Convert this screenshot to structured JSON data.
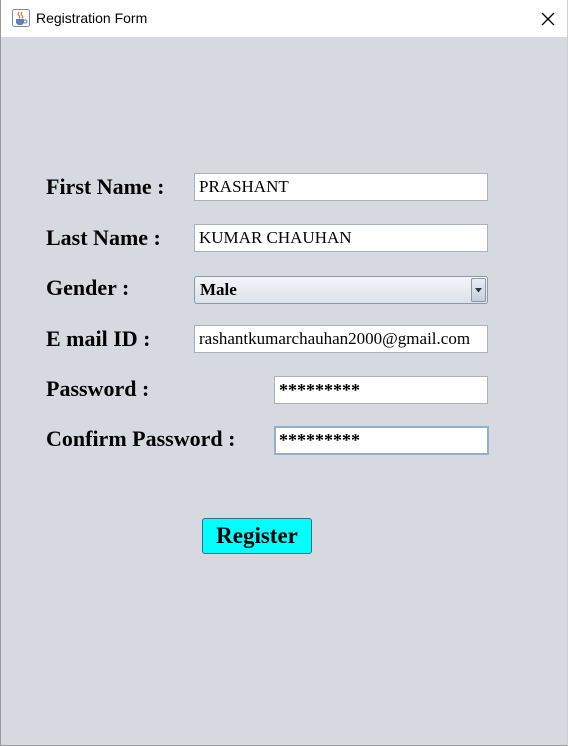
{
  "window": {
    "title": "Registration Form",
    "icons": {
      "app": "java-cup-icon",
      "close": "close-icon"
    }
  },
  "form": {
    "first_name": {
      "label": "First Name :",
      "value": "PRASHANT"
    },
    "last_name": {
      "label": "Last Name :",
      "value": "KUMAR CHAUHAN"
    },
    "gender": {
      "label": "Gender :",
      "selected": "Male"
    },
    "email": {
      "label": "E mail ID :",
      "value": "rashantkumarchauhan2000@gmail.com"
    },
    "password": {
      "label": "Password :",
      "masked_value": "*********"
    },
    "confirm_password": {
      "label": "Confirm Password :",
      "masked_value": "*********"
    },
    "register_label": "Register"
  },
  "colors": {
    "background": "#d6d9e0",
    "register_button": "#00ffff",
    "focus_border": "#94aecb"
  }
}
